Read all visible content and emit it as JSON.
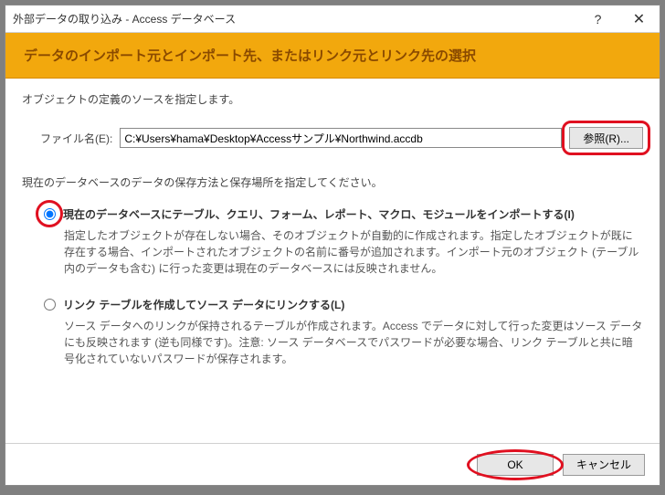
{
  "titlebar": {
    "title": "外部データの取り込み - Access データベース",
    "help": "?",
    "close": "✕"
  },
  "header": {
    "heading": "データのインポート元とインポート先、またはリンク元とリンク先の選択"
  },
  "intro": "オブジェクトの定義のソースを指定します。",
  "file": {
    "label": "ファイル名(E):",
    "value": "C:¥Users¥hama¥Desktop¥Accessサンプル¥Northwind.accdb",
    "browse_label": "参照(R)..."
  },
  "prompt2": "現在のデータベースのデータの保存方法と保存場所を指定してください。",
  "options": [
    {
      "title": "現在のデータベースにテーブル、クエリ、フォーム、レポート、マクロ、モジュールをインポートする(I)",
      "desc": "指定したオブジェクトが存在しない場合、そのオブジェクトが自動的に作成されます。指定したオブジェクトが既に存在する場合、インポートされたオブジェクトの名前に番号が追加されます。インポート元のオブジェクト (テーブル内のデータも含む) に行った変更は現在のデータベースには反映されません。",
      "checked": true
    },
    {
      "title": "リンク テーブルを作成してソース データにリンクする(L)",
      "desc": "ソース データへのリンクが保持されるテーブルが作成されます。Access でデータに対して行った変更はソース データにも反映されます (逆も同様です)。注意: ソース データベースでパスワードが必要な場合、リンク テーブルと共に暗号化されていないパスワードが保存されます。",
      "checked": false
    }
  ],
  "footer": {
    "ok": "OK",
    "cancel": "キャンセル"
  },
  "colors": {
    "accent_band": "#f2a80d",
    "heading_text": "#8a4a00",
    "highlight": "#e01020"
  }
}
